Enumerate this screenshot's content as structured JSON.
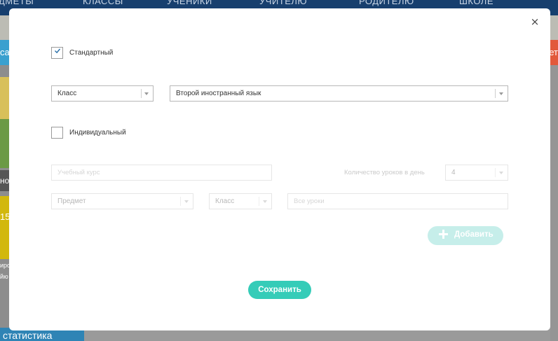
{
  "background": {
    "nav": [
      "ДМЕТЫ",
      "КЛАССЫ",
      "УЧЕНИКИ",
      "УЧИТЕЛЮ",
      "РОДИТЕЛЮ",
      "ШКОЛЕ"
    ],
    "bluebar_left": "са",
    "bluebar_right": "ет",
    "grey_label": "но",
    "yellow_label": "15",
    "small_text_1": "иро",
    "small_text_2": "йю",
    "stat_label": "статистика"
  },
  "modal": {
    "close_glyph": "×",
    "standard": {
      "label": "Стандартный",
      "checked": true
    },
    "class_select": {
      "value": "Класс"
    },
    "subject_select": {
      "value": "Второй иностранный язык"
    },
    "individual": {
      "label": "Индивидуальный",
      "checked": false
    },
    "course_input": {
      "placeholder": "Учебный курс"
    },
    "lessons_per_day": {
      "label": "Количество уроков в день",
      "value": "4"
    },
    "subject2_select": {
      "value": "Предмет"
    },
    "class2_select": {
      "value": "Класс"
    },
    "all_lessons_input": {
      "placeholder": "Все уроки"
    },
    "add_button": {
      "label": "Добавить"
    },
    "save_button": {
      "label": "Сохранить"
    }
  },
  "colors": {
    "accent": "#35ccb8",
    "accent_disabled": "#c6eeea",
    "check": "#2a6fa8"
  }
}
